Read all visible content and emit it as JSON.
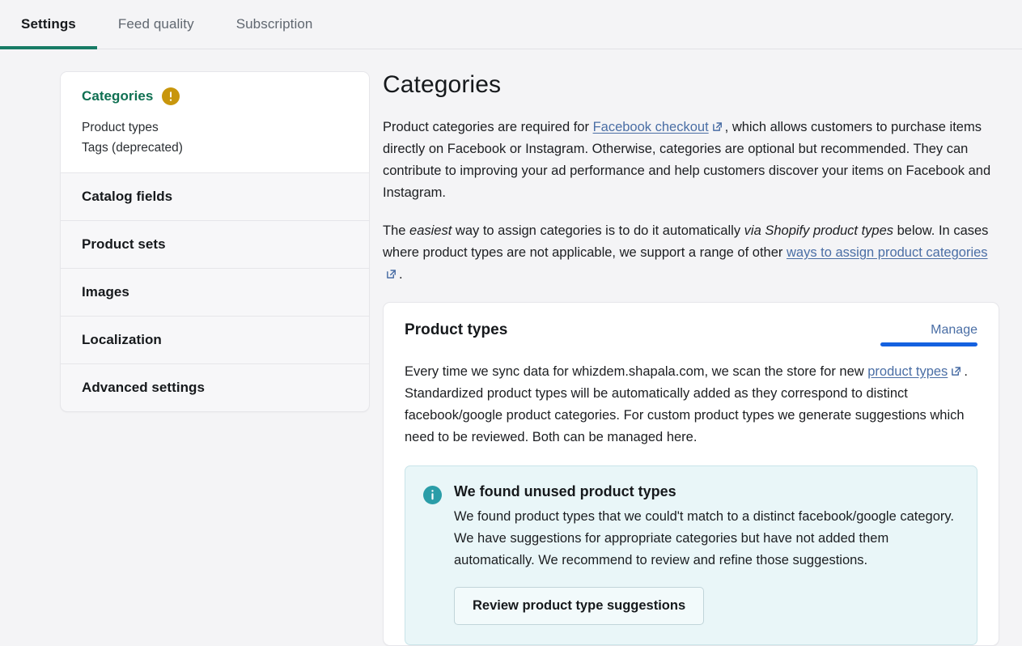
{
  "tabs": [
    {
      "label": "Settings",
      "active": true
    },
    {
      "label": "Feed quality",
      "active": false
    },
    {
      "label": "Subscription",
      "active": false
    }
  ],
  "sidebar": {
    "active_section": {
      "label": "Categories",
      "status_icon": "warning-icon",
      "sub_items": [
        {
          "label": "Product types"
        },
        {
          "label": "Tags (deprecated)"
        }
      ]
    },
    "items": [
      {
        "label": "Catalog fields"
      },
      {
        "label": "Product sets"
      },
      {
        "label": "Images"
      },
      {
        "label": "Localization"
      },
      {
        "label": "Advanced settings"
      }
    ]
  },
  "main": {
    "title": "Categories",
    "intro": {
      "part1": "Product categories are required for ",
      "link1": "Facebook checkout",
      "part2": ", which allows customers to purchase items directly on Facebook or Instagram. Otherwise, categories are optional but recommended. They can contribute to improving your ad performance and help customers discover your items on Facebook and Instagram."
    },
    "intro2": {
      "part1": "The ",
      "em1": "easiest",
      "part2": " way to assign categories is to do it automatically ",
      "em2": "via Shopify product types",
      "part3": " below. In cases where product types are not applicable, we support a range of other ",
      "link1": "ways to assign product categories",
      "part4": "."
    },
    "card": {
      "title": "Product types",
      "manage_label": "Manage",
      "body": {
        "part1": "Every time we sync data for whizdem.shapala.com, we scan the store for new ",
        "link1": "product types",
        "part2": ". Standardized product types will be automatically added as they correspond to distinct facebook/google product categories. For custom product types we generate suggestions which need to be reviewed. Both can be managed here."
      },
      "banner": {
        "icon": "info-icon",
        "title": "We found unused product types",
        "text": "We found product types that we could't match to a distinct facebook/google category. We have suggestions for appropriate categories but have not added them automatically. We recommend to review and refine those suggestions.",
        "button_label": "Review product type suggestions"
      }
    }
  },
  "colors": {
    "accent_green": "#177b65",
    "sidebar_active_text": "#0f7052",
    "link_blue": "#4a6ea5",
    "focus_blue": "#1461e0",
    "warning_amber": "#c8960c",
    "info_teal": "#2a9da8",
    "banner_bg": "#e9f6f8",
    "page_bg": "#f4f4f6"
  }
}
